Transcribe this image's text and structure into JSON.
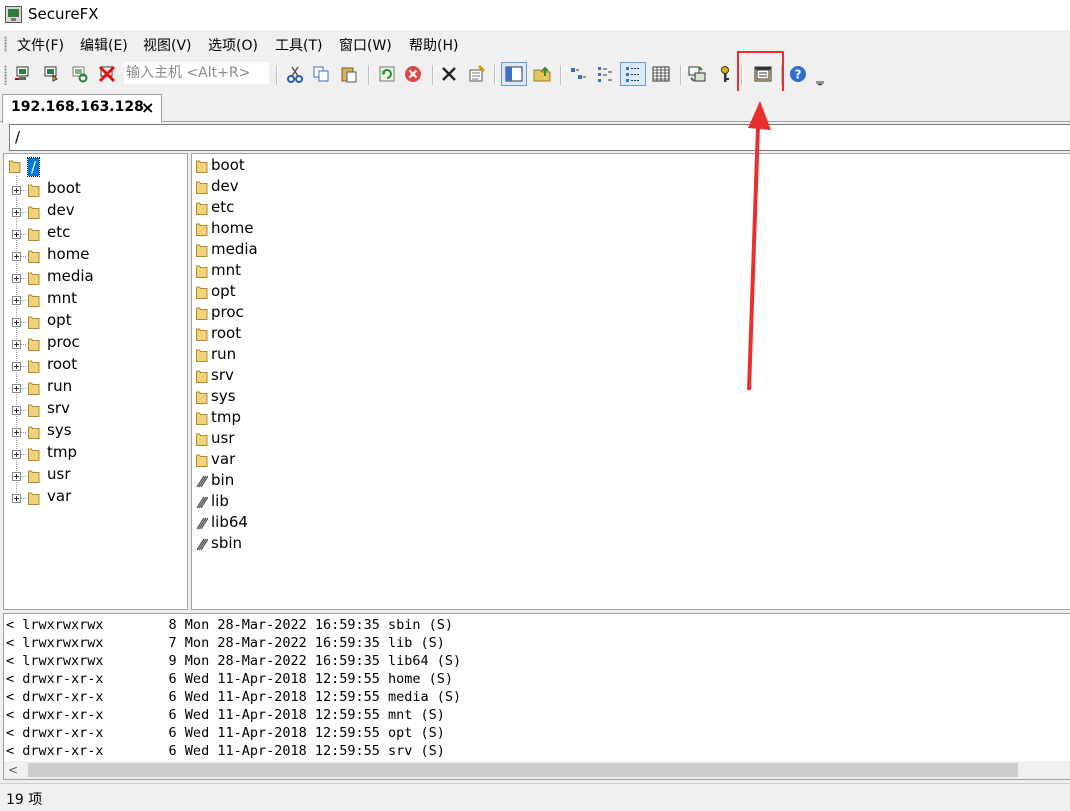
{
  "window": {
    "title": "SecureFX"
  },
  "menu": [
    "文件(F)",
    "编辑(E)",
    "视图(V)",
    "选项(O)",
    "工具(T)",
    "窗口(W)",
    "帮助(H)"
  ],
  "toolbar": {
    "host_placeholder": "输入主机 <Alt+R>",
    "icons": [
      "connect-icon",
      "quick-connect-icon",
      "reconnect-icon",
      "disconnect-icon",
      "cut-icon",
      "copy-icon",
      "paste-icon",
      "refresh-icon",
      "stop-icon",
      "delete-icon",
      "properties-icon",
      "tree-view-icon",
      "up-folder-icon",
      "small-icons-view-icon",
      "list-view-icon",
      "details-view-icon",
      "columns-view-icon",
      "sync-icon",
      "key-icon",
      "session-manager-icon",
      "help-icon"
    ],
    "highlight_color": "#e8302f"
  },
  "tab": {
    "label": "192.168.163.128",
    "close": "×"
  },
  "path": "/",
  "tree": {
    "root": "/",
    "items": [
      "boot",
      "dev",
      "etc",
      "home",
      "media",
      "mnt",
      "opt",
      "proc",
      "root",
      "run",
      "srv",
      "sys",
      "tmp",
      "usr",
      "var"
    ]
  },
  "list": {
    "folders": [
      "boot",
      "dev",
      "etc",
      "home",
      "media",
      "mnt",
      "opt",
      "proc",
      "root",
      "run",
      "srv",
      "sys",
      "tmp",
      "usr",
      "var"
    ],
    "links": [
      "bin",
      "lib",
      "lib64",
      "sbin"
    ]
  },
  "log": [
    "< lrwxrwxrwx        8 Mon 28-Mar-2022 16:59:35 sbin (S)",
    "< lrwxrwxrwx        7 Mon 28-Mar-2022 16:59:35 lib (S)",
    "< lrwxrwxrwx        9 Mon 28-Mar-2022 16:59:35 lib64 (S)",
    "< drwxr-xr-x        6 Wed 11-Apr-2018 12:59:55 home (S)",
    "< drwxr-xr-x        6 Wed 11-Apr-2018 12:59:55 media (S)",
    "< drwxr-xr-x        6 Wed 11-Apr-2018 12:59:55 mnt (S)",
    "< drwxr-xr-x        6 Wed 11-Apr-2018 12:59:55 opt (S)",
    "< drwxr-xr-x        6 Wed 11-Apr-2018 12:59:55 srv (S)"
  ],
  "status": "19 项"
}
